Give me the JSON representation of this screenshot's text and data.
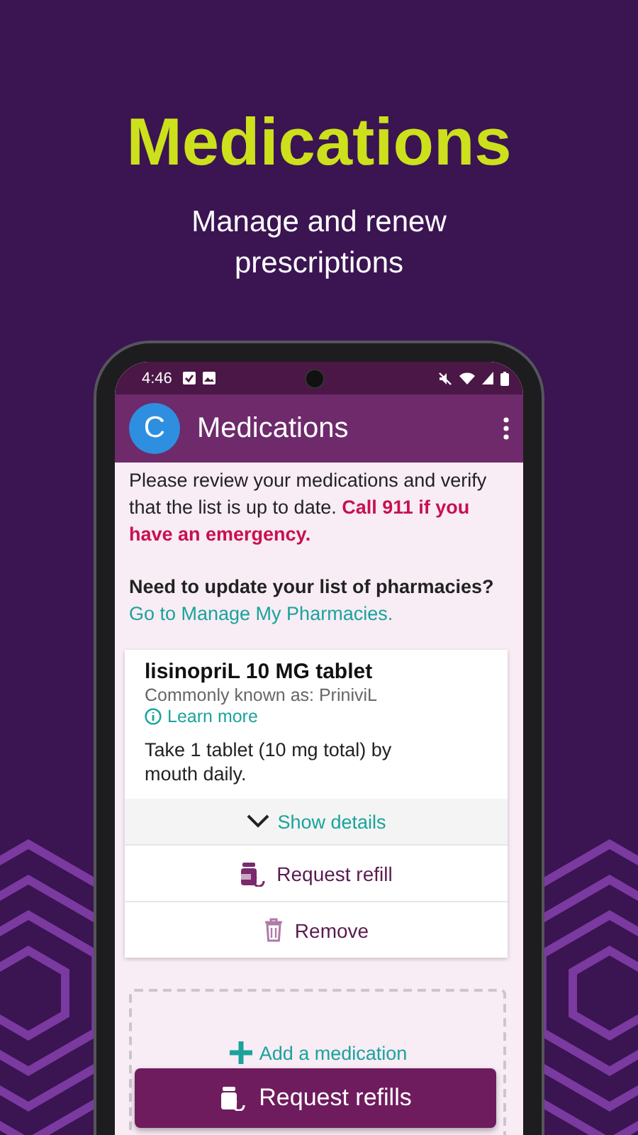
{
  "hero": {
    "title": "Medications",
    "subtitle": "Manage and renew prescriptions"
  },
  "status_bar": {
    "time": "4:46"
  },
  "app_bar": {
    "avatar": "C",
    "title": "Medications"
  },
  "intro": "Please review your medications and verify that the list is up to date. **Call 911 if you have an emergency.**",
  "pharmacies": {
    "question": "Need to update your list of pharmacies?",
    "link": "Go to Manage My Pharmacies."
  },
  "medications": [
    {
      "name": "lisinopriL 10 MG tablet",
      "known_as": "Commonly known as: PriniviL",
      "learn_more": "Learn more",
      "instructions": "Take 1 tablet (10 mg total) by mouth daily.",
      "details_toggle": "Show details",
      "expanded": false,
      "actions": [
        {
          "kind": "refill",
          "label": "Request refill"
        },
        {
          "kind": "remove",
          "label": "Remove"
        }
      ]
    }
  ],
  "add_medication": "Add a medication",
  "footer_button": "Request refills"
}
